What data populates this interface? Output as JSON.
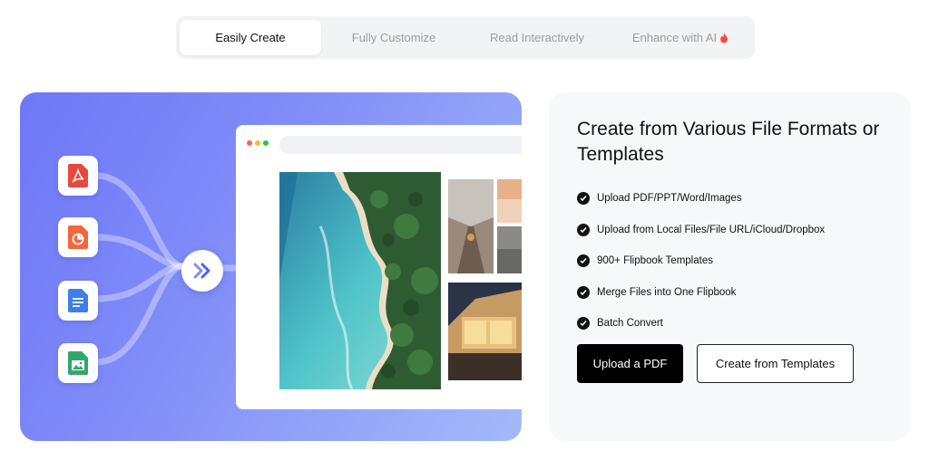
{
  "tabs": [
    {
      "label": "Easily Create",
      "active": true
    },
    {
      "label": "Fully Customize",
      "active": false
    },
    {
      "label": "Read Interactively",
      "active": false
    },
    {
      "label": "Enhance with AI",
      "active": false,
      "icon": "flame-icon"
    }
  ],
  "hero": {
    "file_icons": [
      "pdf-file-icon",
      "ppt-file-icon",
      "word-file-icon",
      "image-file-icon"
    ],
    "convert_icon": "double-chevron-right-icon",
    "colors": {
      "gradient_start": "#6e77f7",
      "gradient_end": "#a3baf9",
      "pdf": "#e8493f",
      "ppt": "#f2673c",
      "word": "#3f7ee8",
      "image": "#33a66b"
    }
  },
  "card": {
    "title": "Create from Various File Formats or Templates",
    "features": [
      "Upload PDF/PPT/Word/Images",
      "Upload from Local Files/File URL/iCloud/Dropbox",
      "900+ Flipbook Templates",
      "Merge Files into One Flipbook",
      "Batch Convert"
    ],
    "primary_button": "Upload a PDF",
    "secondary_button": "Create from Templates"
  }
}
